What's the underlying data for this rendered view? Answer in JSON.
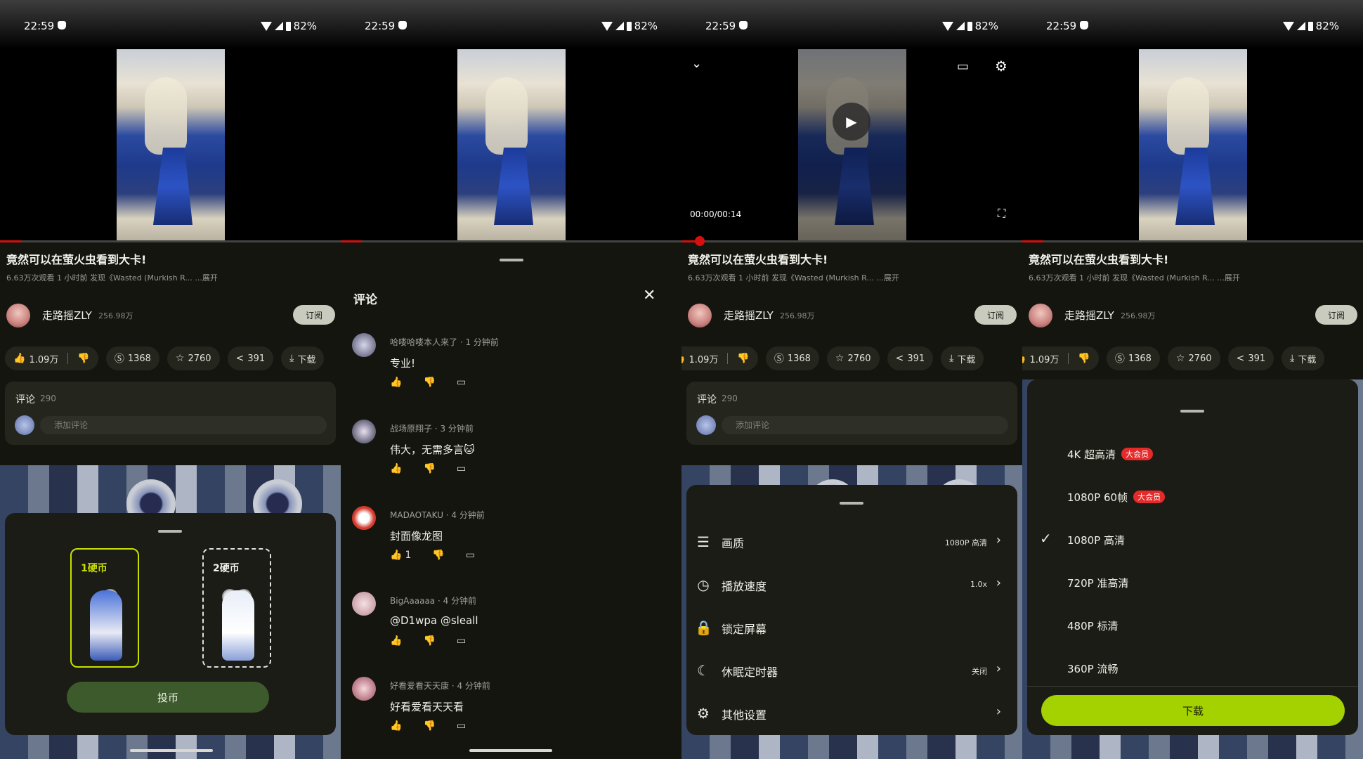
{
  "status": {
    "time": "22:59",
    "battery": "82%"
  },
  "video": {
    "title": "竟然可以在萤火虫看到大卡!",
    "meta": "6.63万次观看 1 小时前 发现《Wasted (Murkish R... ...展开",
    "uploader": "走路摇ZLY",
    "fans": "256.98万",
    "subscribe": "订阅",
    "time_display": "00:00/00:14"
  },
  "actions": {
    "like": "1.09万",
    "coin": "1368",
    "fav": "2760",
    "share": "391",
    "download": "下载"
  },
  "comment_card": {
    "label": "评论",
    "count": "290",
    "placeholder": "添加评论"
  },
  "coin_sheet": {
    "opt1": "1硬币",
    "opt2": "2硬币",
    "button": "投币"
  },
  "comments": {
    "title": "评论",
    "items": [
      {
        "user": "哈喽哈喽本人来了 · 1 分钟前",
        "text": "专业!",
        "likes": ""
      },
      {
        "user": "战场原翔子 · 3 分钟前",
        "text": "伟大，无需多言🐱",
        "likes": ""
      },
      {
        "user": "MADAOTAKU · 4 分钟前",
        "text": "封面像龙图",
        "likes": "1"
      },
      {
        "user": "BigAaaaaa · 4 分钟前",
        "text": "@D1wpa @sleall",
        "likes": ""
      },
      {
        "user": "好看爱看天天康 · 4 分钟前",
        "text": "好看爱看天天看",
        "likes": ""
      }
    ]
  },
  "settings": {
    "rows": [
      {
        "label": "画质",
        "value": "1080P 高清"
      },
      {
        "label": "播放速度",
        "value": "1.0x"
      },
      {
        "label": "锁定屏幕",
        "value": ""
      },
      {
        "label": "休眠定时器",
        "value": "关闭"
      },
      {
        "label": "其他设置",
        "value": ""
      }
    ]
  },
  "quality": {
    "rows": [
      {
        "label": "4K 超高清",
        "badge": "大会员",
        "selected": false
      },
      {
        "label": "1080P 60帧",
        "badge": "大会员",
        "selected": false
      },
      {
        "label": "1080P 高清",
        "badge": "",
        "selected": true
      },
      {
        "label": "720P 准高清",
        "badge": "",
        "selected": false
      },
      {
        "label": "480P 标清",
        "badge": "",
        "selected": false
      },
      {
        "label": "360P 流畅",
        "badge": "",
        "selected": false
      }
    ],
    "button": "下载"
  },
  "colors": {
    "accent_green": "#a4d200",
    "badge_red": "#e52a2a",
    "progress_red": "#d80f0f",
    "coin_highlight": "#c8e000"
  }
}
